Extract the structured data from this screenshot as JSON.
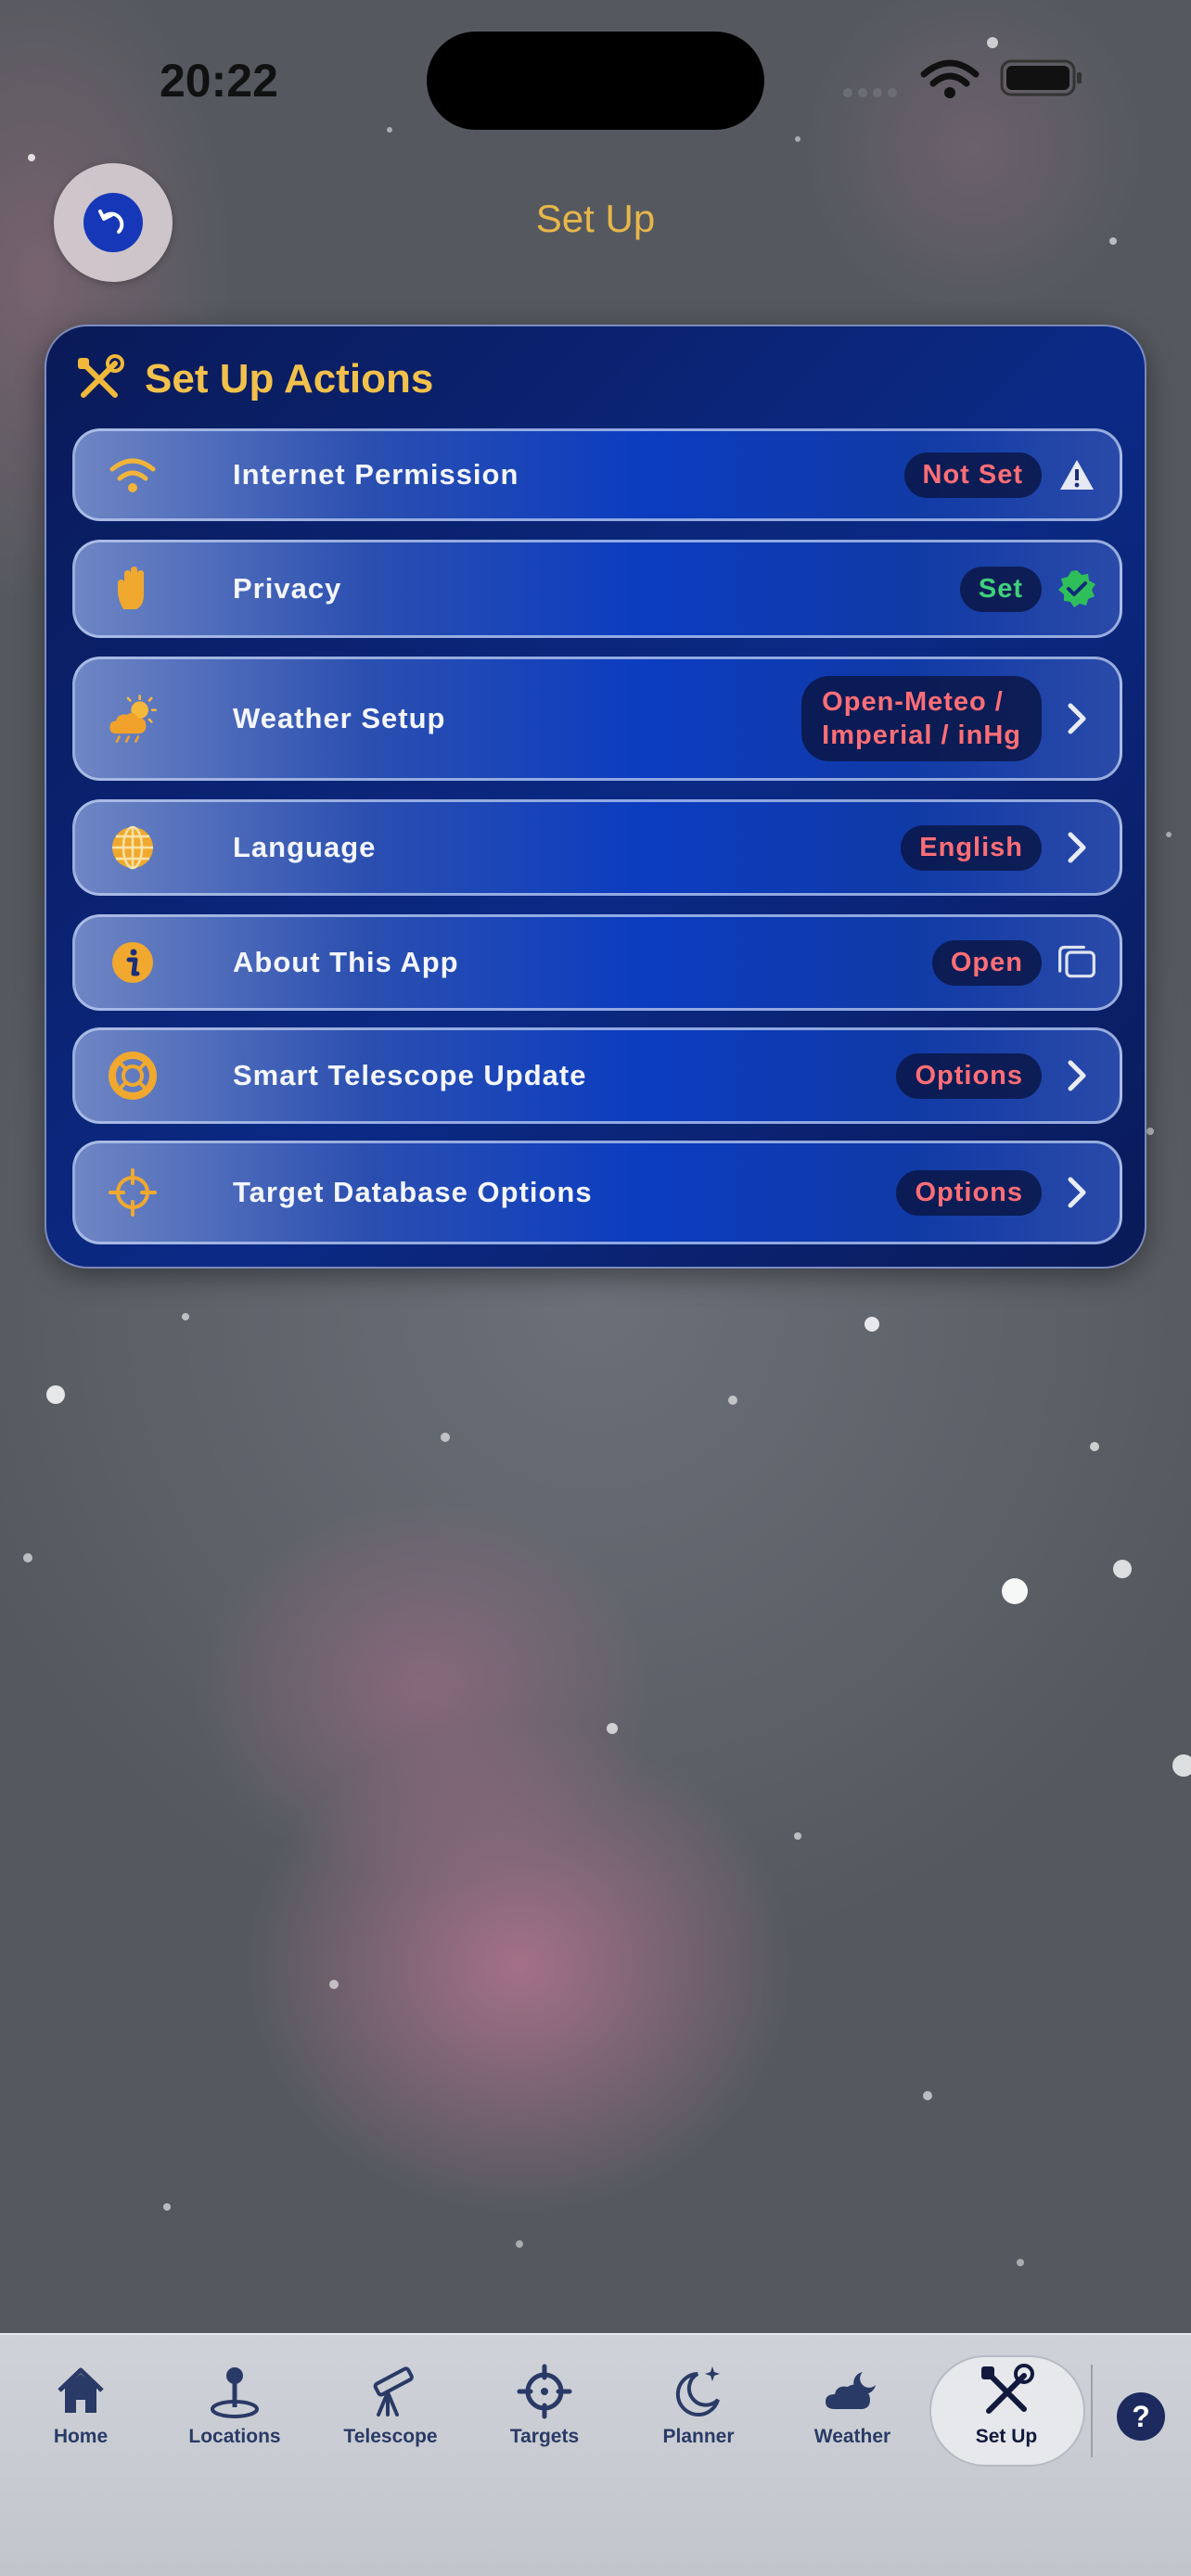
{
  "status_bar": {
    "time": "20:22"
  },
  "header": {
    "title": "Set Up"
  },
  "card": {
    "title": "Set Up Actions",
    "rows": [
      {
        "label": "Internet Permission",
        "value": "Not Set",
        "value_color": "#ff6e76",
        "icon": "wifi-icon",
        "trailing": "warning-icon"
      },
      {
        "label": "Privacy",
        "value": "Set",
        "value_color": "#3fd07a",
        "icon": "hand-icon",
        "trailing": "verified-check-icon"
      },
      {
        "label": "Weather Setup",
        "value_line1": "Open-Meteo /",
        "value_line2": "Imperial / inHg",
        "value_color": "#ff6e76",
        "icon": "sun-cloud-icon",
        "trailing": "chevron-right-icon"
      },
      {
        "label": "Language",
        "value": "English",
        "value_color": "#ff6e76",
        "icon": "globe-icon",
        "trailing": "chevron-right-icon"
      },
      {
        "label": "About This App",
        "value": "Open",
        "value_color": "#ff6e76",
        "icon": "info-icon",
        "trailing": "windows-icon"
      },
      {
        "label": "Smart Telescope Update",
        "value": "Options",
        "value_color": "#ff6e76",
        "icon": "lifebuoy-icon",
        "trailing": "chevron-right-icon"
      },
      {
        "label": "Target Database Options",
        "value": "Options",
        "value_color": "#ff6e76",
        "icon": "crosshair-icon",
        "trailing": "chevron-right-icon"
      }
    ]
  },
  "tabs": [
    {
      "label": "Home",
      "icon": "house-icon"
    },
    {
      "label": "Locations",
      "icon": "map-pin-icon"
    },
    {
      "label": "Telescope",
      "icon": "telescope-icon"
    },
    {
      "label": "Targets",
      "icon": "crosshair-icon"
    },
    {
      "label": "Planner",
      "icon": "moon-stars-icon"
    },
    {
      "label": "Weather",
      "icon": "cloud-moon-icon"
    },
    {
      "label": "Set Up",
      "icon": "tools-icon",
      "active": true
    }
  ],
  "help": {
    "label": "?"
  },
  "colors": {
    "accent_gold": "#e8b64a",
    "card_blue": "#0b3cc0",
    "tab_text": "#2a3a66"
  }
}
